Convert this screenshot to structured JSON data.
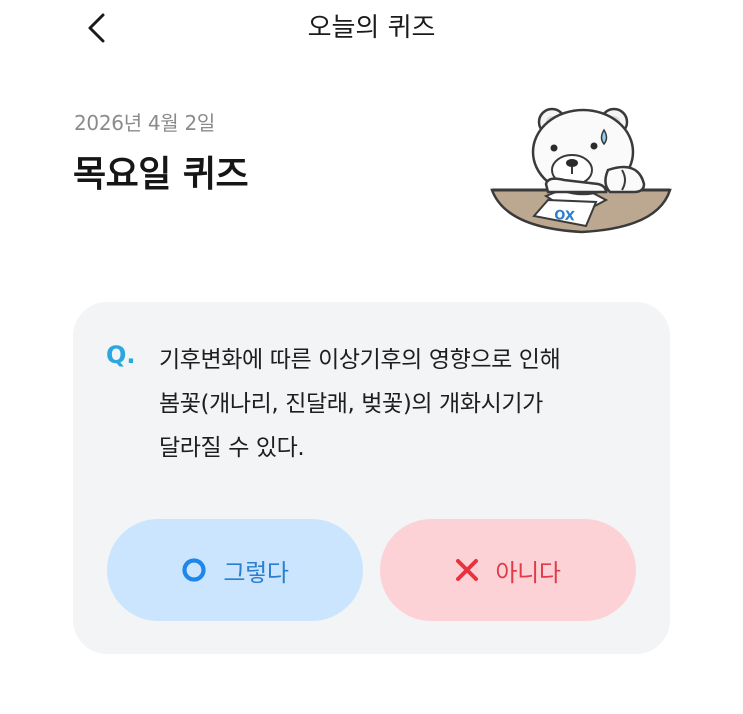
{
  "header": {
    "title": "오늘의 퀴즈",
    "back_icon": "chevron-left-icon"
  },
  "quiz": {
    "date": "2026년 4월 2일",
    "title": "목요일 퀴즈",
    "mascot": {
      "icon": "polar-bear-mascot",
      "paper_text": "OX"
    },
    "question_prefix": "Q.",
    "question_lines": [
      "기후변화에 따른 이상기후의 영향으로 인해",
      "봄꽃(개나리, 진달래, 벚꽃)의 개화시기가",
      "달라질 수 있다."
    ],
    "answers": {
      "yes": {
        "label": "그렇다",
        "icon": "circle-o-icon"
      },
      "no": {
        "label": "아니다",
        "icon": "x-mark-icon"
      }
    }
  },
  "colors": {
    "accent_q": "#2aa7df",
    "yes_bg": "#cae5fd",
    "yes_fg": "#2a7fcf",
    "no_bg": "#fdd2d6",
    "no_fg": "#e23b48",
    "card_bg": "#f3f4f6"
  }
}
